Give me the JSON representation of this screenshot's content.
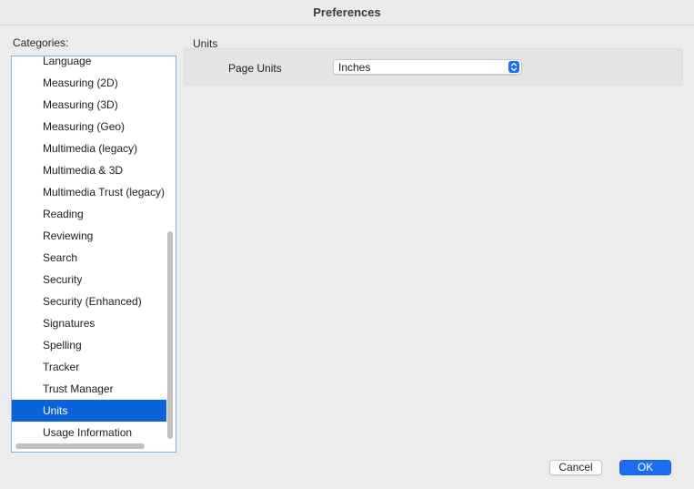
{
  "window": {
    "title": "Preferences"
  },
  "sidebar": {
    "label": "Categories:",
    "items": [
      {
        "label": "Language"
      },
      {
        "label": "Measuring (2D)"
      },
      {
        "label": "Measuring (3D)"
      },
      {
        "label": "Measuring (Geo)"
      },
      {
        "label": "Multimedia (legacy)"
      },
      {
        "label": "Multimedia & 3D"
      },
      {
        "label": "Multimedia Trust (legacy)"
      },
      {
        "label": "Reading"
      },
      {
        "label": "Reviewing"
      },
      {
        "label": "Search"
      },
      {
        "label": "Security"
      },
      {
        "label": "Security (Enhanced)"
      },
      {
        "label": "Signatures"
      },
      {
        "label": "Spelling"
      },
      {
        "label": "Tracker"
      },
      {
        "label": "Trust Manager"
      },
      {
        "label": "Units"
      },
      {
        "label": "Usage Information"
      }
    ],
    "selected": "Units"
  },
  "main": {
    "section_title": "Units",
    "page_units_label": "Page Units",
    "page_units_value": "Inches"
  },
  "footer": {
    "cancel_label": "Cancel",
    "ok_label": "OK"
  },
  "colors": {
    "accent": "#1b6ef0",
    "selection": "#0a63d8"
  },
  "icons": {
    "select_arrows": "chevron-up-down-icon"
  }
}
